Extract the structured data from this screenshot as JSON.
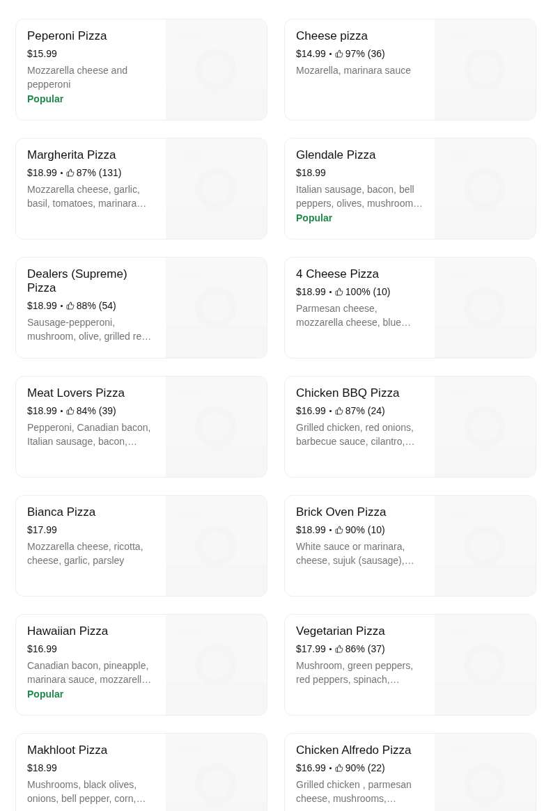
{
  "items": [
    {
      "name": "Peperoni Pizza",
      "price": "$15.99",
      "description": "Mozzarella cheese and pepperoni",
      "badge": "Popular"
    },
    {
      "name": "Cheese pizza",
      "price": "$14.99",
      "rating": "97% (36)",
      "description": "Mozarella, marinara sauce"
    },
    {
      "name": "Margherita Pizza",
      "price": "$18.99",
      "rating": "87% (131)",
      "description": "Mozzarella cheese, garlic, basil, tomatoes, marinara…"
    },
    {
      "name": "Glendale Pizza",
      "price": "$18.99",
      "description": "Italian sausage, bacon, bell peppers, olives, mushroom…",
      "badge": "Popular"
    },
    {
      "name": "Dealers (Supreme) Pizza",
      "price": "$18.99",
      "rating": "88% (54)",
      "description": "Sausage-pepperoni, mushroom, olive, grilled re…"
    },
    {
      "name": "4 Cheese Pizza",
      "price": "$18.99",
      "rating": "100% (10)",
      "description": "Parmesan cheese, mozzarella cheese, blue…"
    },
    {
      "name": "Meat Lovers Pizza",
      "price": "$18.99",
      "rating": "84% (39)",
      "description": "Pepperoni, Canadian bacon, Italian sausage, bacon,…"
    },
    {
      "name": "Chicken BBQ Pizza",
      "price": "$16.99",
      "rating": "87% (24)",
      "description": "Grilled chicken, red onions, barbecue sauce, cilantro,…"
    },
    {
      "name": "Bianca Pizza",
      "price": "$17.99",
      "description": "Mozzarella cheese, ricotta, cheese, garlic, parsley"
    },
    {
      "name": "Brick  Oven Pizza",
      "price": "$18.99",
      "rating": "90% (10)",
      "description": "White sauce or marinara, cheese, sujuk (sausage),…"
    },
    {
      "name": "Hawaiian Pizza",
      "price": "$16.99",
      "description": "Canadian bacon, pineapple, marinara sauce, mozzarell…",
      "badge": "Popular"
    },
    {
      "name": "Vegetarian Pizza",
      "price": "$17.99",
      "rating": "86% (37)",
      "description": "Mushroom, green peppers, red peppers, spinach,…"
    },
    {
      "name": "Makhloot Pizza",
      "price": "$18.99",
      "description": "Mushrooms, black olives, onions, bell pepper, corn,…"
    },
    {
      "name": "Chicken Alfredo Pizza",
      "price": "$16.99",
      "rating": "90% (22)",
      "description": "Grilled chicken , parmesan cheese, mushrooms,…"
    }
  ]
}
